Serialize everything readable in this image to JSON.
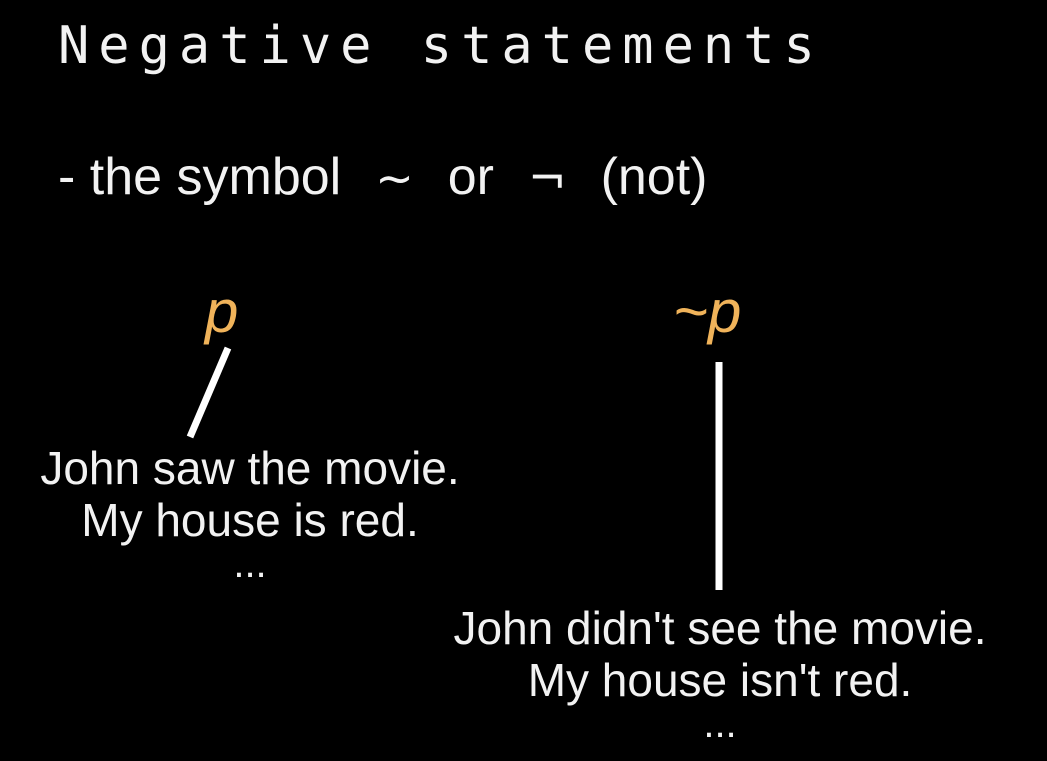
{
  "slide": {
    "title": "Negative statements",
    "subtitle": {
      "prefix": "- the symbol",
      "tilde": "~",
      "or": "or",
      "not_sign": "¬",
      "suffix": "(not)"
    },
    "positive": {
      "variable": "p",
      "examples": [
        "John saw the movie.",
        "My house is red.",
        "..."
      ]
    },
    "negative": {
      "variable": "~p",
      "examples": [
        "John didn't see the movie.",
        "My house isn't red.",
        "..."
      ]
    },
    "colors": {
      "background": "#000000",
      "text": "#f2f2f2",
      "variable": "#f0b35a"
    }
  }
}
